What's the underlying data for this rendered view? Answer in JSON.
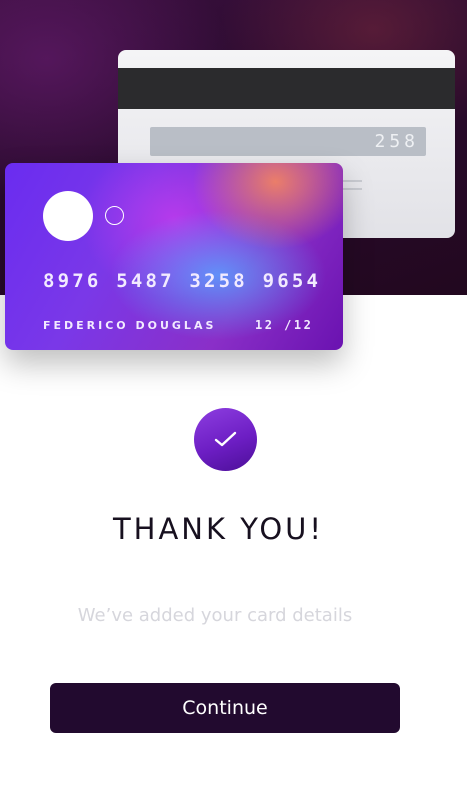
{
  "card_back": {
    "cvv": "258"
  },
  "card_front": {
    "number": "8976 5487 3258 9654",
    "holder": "FEDERICO DOUGLAS",
    "expiry": "12 /12"
  },
  "success": {
    "icon": "check-icon",
    "title": "THANK YOU!",
    "subtitle": "We’ve added your card details"
  },
  "actions": {
    "continue_label": "Continue"
  },
  "colors": {
    "hero_background": "#2a0b2e",
    "accent": "#6d1ec4",
    "button_background": "#220a2f",
    "title_text": "#17101f",
    "subtitle_text": "#d6d6dc"
  }
}
